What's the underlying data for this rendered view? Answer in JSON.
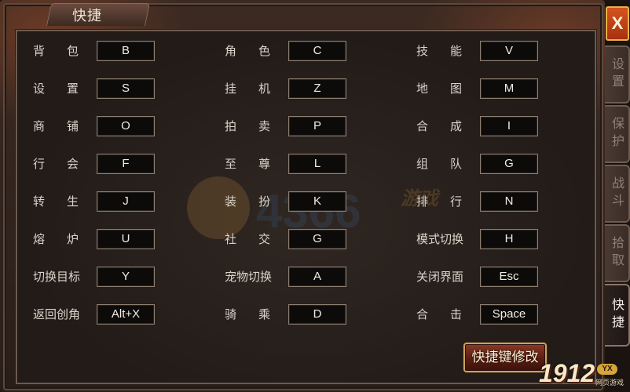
{
  "window": {
    "title": "快捷"
  },
  "close_label": "X",
  "side_tabs": [
    {
      "label": "设置",
      "active": false
    },
    {
      "label": "保护",
      "active": false
    },
    {
      "label": "战斗",
      "active": false
    },
    {
      "label": "拾取",
      "active": false
    },
    {
      "label": "快捷",
      "active": true
    }
  ],
  "shortcuts": [
    {
      "label": "背包",
      "key": "B"
    },
    {
      "label": "角色",
      "key": "C"
    },
    {
      "label": "技能",
      "key": "V"
    },
    {
      "label": "设置",
      "key": "S"
    },
    {
      "label": "挂机",
      "key": "Z"
    },
    {
      "label": "地图",
      "key": "M"
    },
    {
      "label": "商铺",
      "key": "O"
    },
    {
      "label": "拍卖",
      "key": "P"
    },
    {
      "label": "合成",
      "key": "I"
    },
    {
      "label": "行会",
      "key": "F"
    },
    {
      "label": "至尊",
      "key": "L"
    },
    {
      "label": "组队",
      "key": "G"
    },
    {
      "label": "转生",
      "key": "J"
    },
    {
      "label": "装扮",
      "key": "K"
    },
    {
      "label": "排行",
      "key": "N"
    },
    {
      "label": "熔炉",
      "key": "U"
    },
    {
      "label": "社交",
      "key": "G"
    },
    {
      "label": "模式切换",
      "key": "H"
    },
    {
      "label": "切换目标",
      "key": "Y"
    },
    {
      "label": "宠物切换",
      "key": "A"
    },
    {
      "label": "关闭界面",
      "key": "Esc"
    },
    {
      "label": "返回创角",
      "key": "Alt+X"
    },
    {
      "label": "骑乘",
      "key": "D"
    },
    {
      "label": "合击",
      "key": "Space"
    }
  ],
  "modify_button": "快捷键修改",
  "watermark": {
    "text": "4366",
    "suffix": "游戏"
  },
  "logo": {
    "main": "1912",
    "badge": "YX",
    "sub": "网页游戏"
  }
}
